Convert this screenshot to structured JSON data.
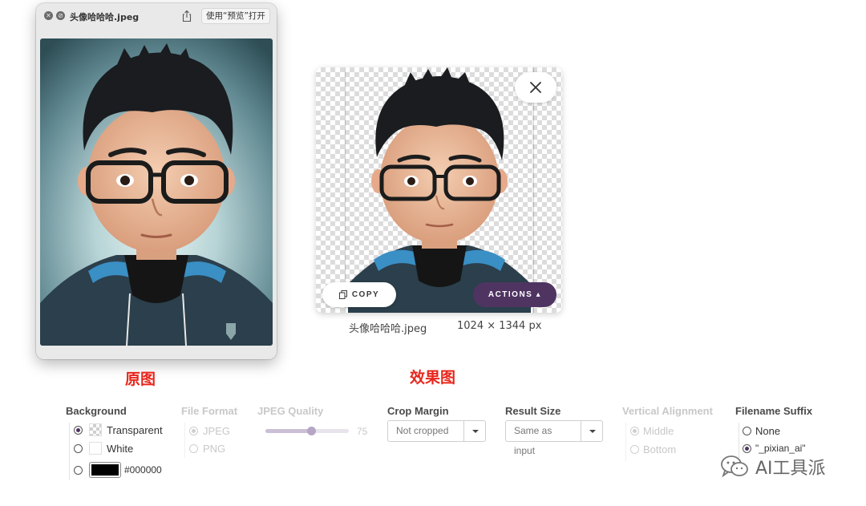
{
  "preview_window": {
    "title": "头像哈哈哈.jpeg",
    "open_with_label": "使用“预览”打开"
  },
  "result": {
    "copy_label": "COPY",
    "actions_label": "ACTIONS ▴",
    "file_name": "头像哈哈哈.jpeg",
    "dimensions": "1024 × 1344 px"
  },
  "captions": {
    "original": "原图",
    "result": "效果图"
  },
  "settings": {
    "background": {
      "heading": "Background",
      "options": [
        "Transparent",
        "White",
        "#000000"
      ],
      "selected": "Transparent",
      "color_value": "#000000"
    },
    "file_format": {
      "heading": "File Format",
      "options": [
        "JPEG",
        "PNG"
      ],
      "selected": "JPEG",
      "disabled": true
    },
    "jpeg_quality": {
      "heading": "JPEG Quality",
      "value": "75",
      "level_percent": 75,
      "disabled": true
    },
    "crop_margin": {
      "heading": "Crop Margin",
      "value": "Not cropped"
    },
    "result_size": {
      "heading": "Result Size",
      "value": "Same as input"
    },
    "vertical_alignment": {
      "heading": "Vertical Alignment",
      "options": [
        "Middle",
        "Bottom"
      ],
      "selected": "Middle",
      "disabled": true
    },
    "filename_suffix": {
      "heading": "Filename Suffix",
      "options": [
        "None",
        "\"_pixian_ai\""
      ],
      "selected": "\"_pixian_ai\""
    }
  },
  "watermark": {
    "text": "AI工具派",
    "icon": "wechat-icon"
  },
  "colors": {
    "accent": "#4f3462",
    "caption_red": "#e8261c",
    "checker": "#dcdcdc"
  }
}
